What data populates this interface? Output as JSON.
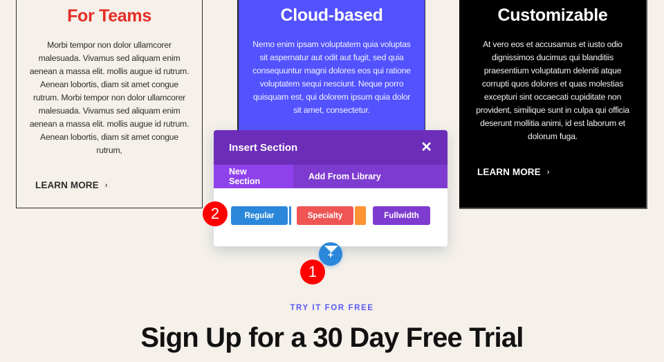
{
  "cards": [
    {
      "title": "For Teams",
      "body": "Morbi tempor non dolor ullamcorer malesuada. Vivamus sed aliquam enim aenean a massa elit. mollis augue id rutrum. Aenean lobortis, diam sit amet congue rutrum. Morbi tempor non dolor ullamcorer malesuada. Vivamus sed aliquam enim aenean a massa elit. mollis augue id rutrum. Aenean lobortis, diam sit amet congue rutrum,",
      "link": "LEARN MORE",
      "title_color": "#e52d27",
      "background": "#f5f0e9"
    },
    {
      "title": "Cloud-based",
      "body": "Nemo enim ipsam voluptatem quia voluptas sit aspernatur aut odit aut fugit, sed quia consequuntur magni dolores eos qui ratione voluptatem sequi nesciunt. Neque porro quisquam est, qui dolorem ipsum quia dolor sit amet, consectetur.",
      "background": "#5252fe"
    },
    {
      "title": "Customizable",
      "body": "At vero eos et accusamus et iusto odio dignissimos ducimus qui blanditiis praesentium voluptatum deleniti atque corrupti quos dolores et quas molestias excepturi sint occaecati cupiditate non provident, similique sunt in culpa qui officia deserunt mollitia animi, id est laborum et dolorum fuga.",
      "link": "LEARN MORE",
      "background": "#000000"
    }
  ],
  "icons": {
    "chevron": "›",
    "close": "✕",
    "plus": "+"
  },
  "modal": {
    "title": "Insert Section",
    "tabs": [
      {
        "label": "New Section",
        "active": true
      },
      {
        "label": "Add From Library",
        "active": false
      }
    ],
    "buttons": [
      {
        "label": "Regular",
        "color": "#2b87da"
      },
      {
        "label": "Specialty",
        "color": "#ef5555",
        "accent": "#ff9232"
      },
      {
        "label": "Fullwidth",
        "color": "#7e3bd0"
      }
    ],
    "header_color": "#6c2eb9",
    "tab_bar_color": "#7e3bd0",
    "active_tab_color": "#8f42ec"
  },
  "annotations": [
    {
      "label": "1"
    },
    {
      "label": "2"
    }
  ],
  "signup": {
    "eyebrow": "TRY IT FOR FREE",
    "headline": "Sign Up for a 30 Day Free Trial",
    "eyebrow_color": "#5a5af5"
  }
}
